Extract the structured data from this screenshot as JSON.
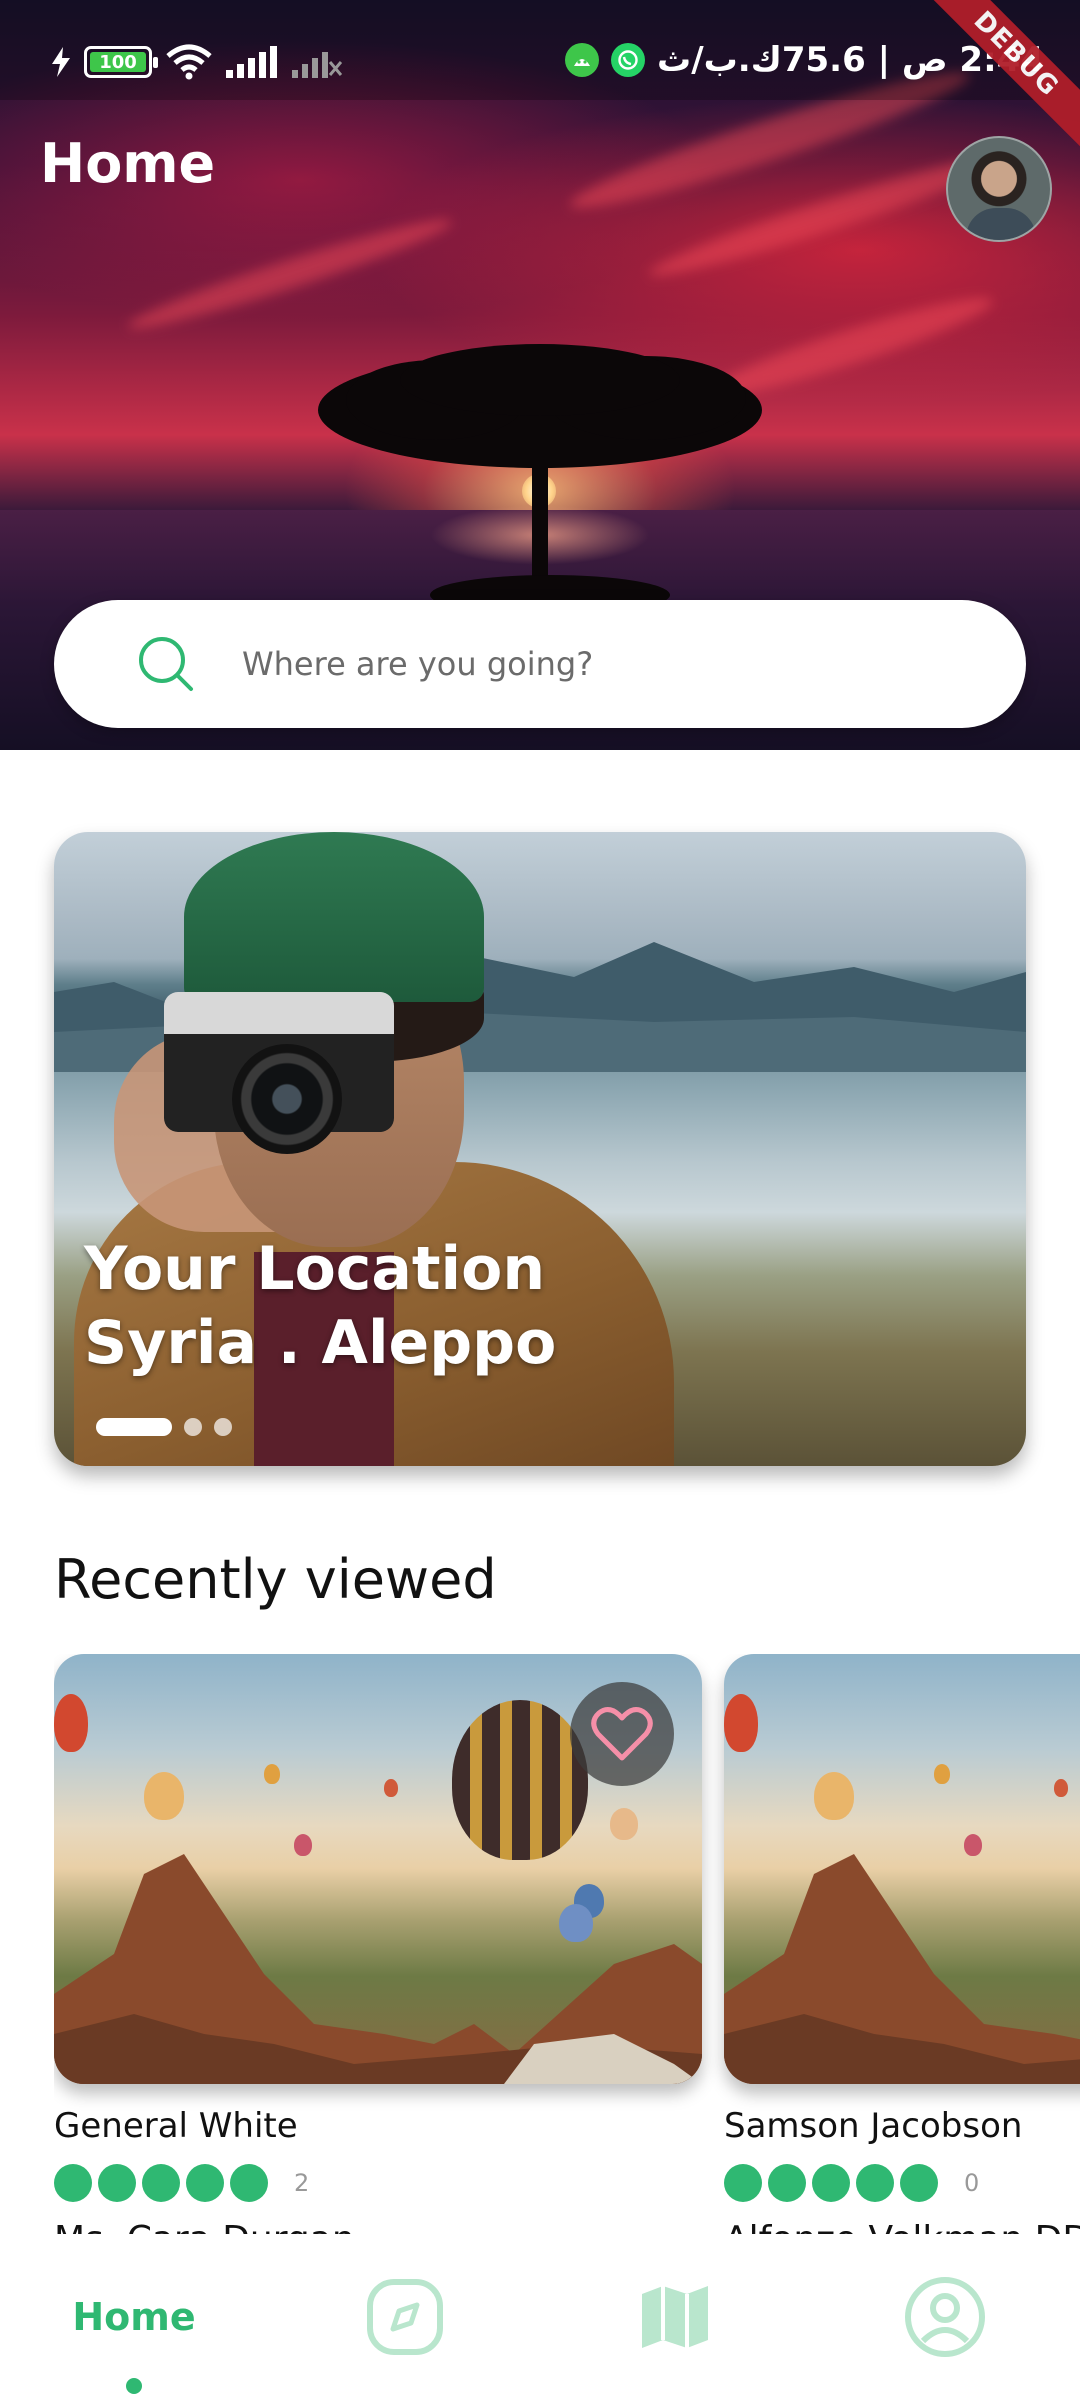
{
  "status_bar": {
    "battery": "100",
    "time_text": "2:44 ص | 75.6ك.ب/ث",
    "debug_label": "DEBUG"
  },
  "header": {
    "title": "Home"
  },
  "search": {
    "placeholder": "Where are you going?"
  },
  "location_card": {
    "line1": "Your Location",
    "line2": "Syria . Aleppo",
    "page_count": 3,
    "active_page": 1
  },
  "recently_viewed": {
    "title": "Recently viewed",
    "items": [
      {
        "name": "General White",
        "rating_count": "2",
        "host": "Ms. Cara Durgan",
        "rating": 5,
        "favorite": true
      },
      {
        "name": "Samson Jacobson",
        "rating_count": "0",
        "host": "Alfonzo Volkman DDS",
        "rating": 5,
        "favorite": false
      }
    ]
  },
  "bottom_nav": {
    "items": [
      {
        "label": "Home",
        "icon": "home",
        "active": true
      },
      {
        "label": "",
        "icon": "compass-icon",
        "active": false
      },
      {
        "label": "",
        "icon": "map-icon",
        "active": false
      },
      {
        "label": "",
        "icon": "profile-icon",
        "active": false
      }
    ]
  },
  "colors": {
    "accent": "#2fb872",
    "accent_light": "#b9e6cd",
    "heart": "#f58fa8"
  }
}
